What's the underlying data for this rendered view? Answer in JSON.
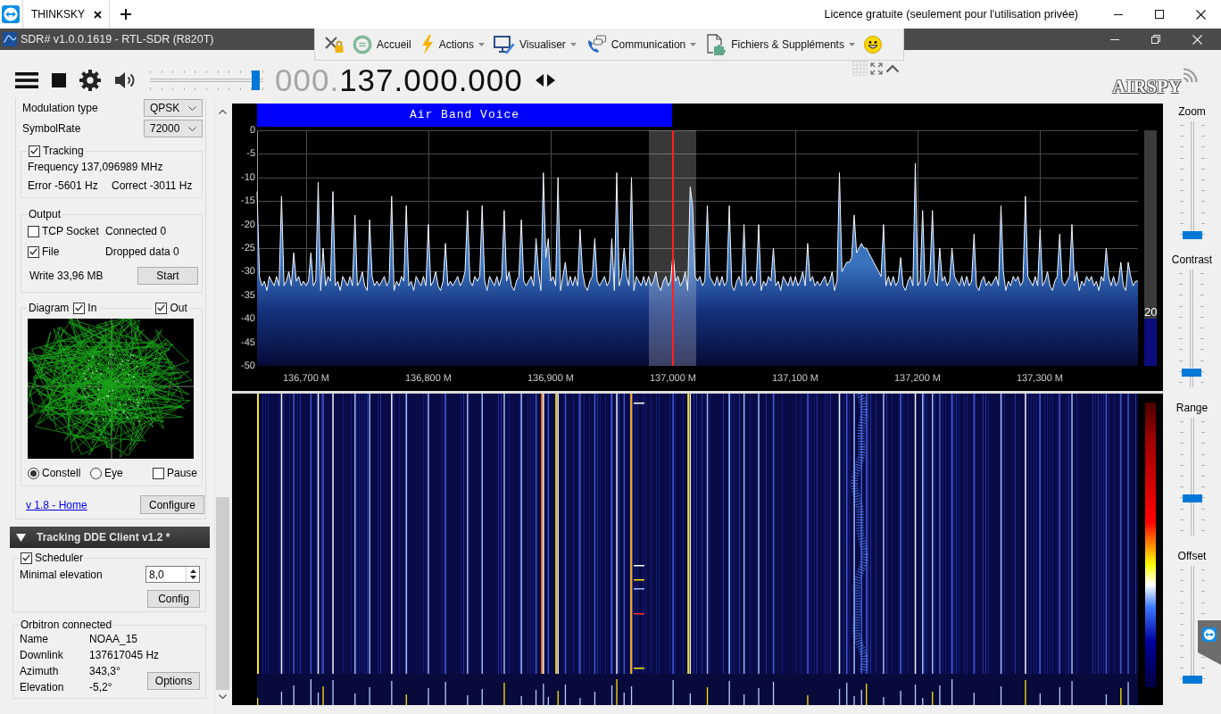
{
  "session_bar": {
    "tabs": [
      {
        "label": "THINKSKY",
        "selected": true
      }
    ],
    "license": "Licence gratuite (seulement pour l'utilisation privée)"
  },
  "window": {
    "title": "SDR# v1.0.0.1619 - RTL-SDR (R820T)"
  },
  "remote_toolbar": {
    "items": [
      {
        "label": "Accueil",
        "dropdown": false
      },
      {
        "label": "Actions",
        "dropdown": true
      },
      {
        "label": "Visualiser",
        "dropdown": true
      },
      {
        "label": "Communication",
        "dropdown": true
      },
      {
        "label": "Fichiers & Suppléments",
        "dropdown": true
      }
    ]
  },
  "radio_toolbar": {
    "volume": {
      "level": 0.97
    },
    "frequency": {
      "leading": "000.",
      "value": "137.000.000"
    },
    "logo": "AIRSPY"
  },
  "demodulator": {
    "fields": [
      {
        "label": "Modulation type",
        "value": "QPSK"
      },
      {
        "label": "SymbolRate",
        "value": "72000"
      }
    ],
    "tracking": {
      "label": "Tracking",
      "checked": true,
      "frequency": "Frequency 137,096989 MHz",
      "error": "Error -5601 Hz",
      "correct": "Correct -3011 Hz"
    },
    "output": {
      "title": "Output",
      "rows": [
        {
          "label": "TCP Socket",
          "checked": false,
          "status": "Connected 0"
        },
        {
          "label": "File",
          "checked": true,
          "status": "Dropped data 0"
        }
      ],
      "write": "Write 33,96 MB",
      "button": "Start"
    },
    "diagram": {
      "title": "Diagram",
      "channels": [
        {
          "label": "In",
          "checked": true
        },
        {
          "label": "Out",
          "checked": true
        }
      ],
      "modes": [
        {
          "label": "Constell",
          "selected": true
        },
        {
          "label": "Eye",
          "selected": false
        }
      ],
      "pause": {
        "label": "Pause",
        "checked": false
      }
    },
    "link": "v 1.8 - Home",
    "button": "Configure"
  },
  "dde_client": {
    "title": "Tracking DDE Client v1.2 *",
    "expanded": true,
    "scheduler": {
      "label": "Scheduler",
      "checked": true,
      "elevation_label": "Minimal elevation",
      "elevation": "8,0",
      "button": "Config"
    },
    "orbitron": {
      "title": "Orbitron connected",
      "rows": [
        {
          "label": "Name",
          "value": "NOAA_15"
        },
        {
          "label": "Downlink",
          "value": "137617045 Hz"
        },
        {
          "label": "Azimuth",
          "value": "343,3°"
        },
        {
          "label": "Elevation",
          "value": "-5,2°"
        }
      ],
      "button": "Options"
    }
  },
  "spectrum": {
    "band": "Air Band Voice",
    "gain": {
      "level": 0.2,
      "reading": "20"
    },
    "chart_data": {
      "type": "area",
      "xlim": [
        136660,
        137380
      ],
      "ylim": [
        -50,
        0
      ],
      "xticks": [
        {
          "value": 136700,
          "label": "136,700 M"
        },
        {
          "value": 136800,
          "label": "136,800 M"
        },
        {
          "value": 136900,
          "label": "136,900 M"
        },
        {
          "value": 137000,
          "label": "137,000 M"
        },
        {
          "value": 137100,
          "label": "137,100 M"
        },
        {
          "value": 137200,
          "label": "137,200 M"
        },
        {
          "value": 137300,
          "label": "137,300 M"
        }
      ],
      "yticks": [
        0,
        -5,
        -10,
        -15,
        -20,
        -25,
        -30,
        -35,
        -40,
        -45,
        -50
      ],
      "x": [
        136660,
        136660,
        136662,
        136664,
        136666,
        136668,
        136670,
        136672,
        136674,
        136676,
        136678,
        136680,
        136682,
        136684,
        136686,
        136688,
        136690,
        136692,
        136694,
        136696,
        136698,
        136700,
        136702,
        136704,
        136706,
        136708,
        136710,
        136712,
        136714,
        136716,
        136718,
        136720,
        136722,
        136724,
        136726,
        136728,
        136730,
        136732,
        136734,
        136736,
        136738,
        136740,
        136742,
        136744,
        136746,
        136748,
        136750,
        136752,
        136754,
        136756,
        136758,
        136760,
        136762,
        136764,
        136766,
        136768,
        136770,
        136772,
        136774,
        136776,
        136778,
        136780,
        136782,
        136784,
        136786,
        136788,
        136790,
        136792,
        136794,
        136796,
        136798,
        136800,
        136802,
        136804,
        136806,
        136808,
        136810,
        136812,
        136814,
        136816,
        136818,
        136820,
        136822,
        136824,
        136826,
        136828,
        136830,
        136832,
        136834,
        136836,
        136838,
        136840,
        136842,
        136844,
        136846,
        136848,
        136850,
        136852,
        136854,
        136856,
        136858,
        136860,
        136862,
        136864,
        136866,
        136868,
        136870,
        136872,
        136874,
        136876,
        136878,
        136880,
        136882,
        136884,
        136886,
        136888,
        136890,
        136892,
        136894,
        136896,
        136898,
        136900,
        136902,
        136904,
        136906,
        136908,
        136910,
        136912,
        136914,
        136916,
        136918,
        136920,
        136922,
        136924,
        136926,
        136928,
        136930,
        136932,
        136934,
        136936,
        136938,
        136940,
        136942,
        136944,
        136946,
        136948,
        136950,
        136952,
        136954,
        136956,
        136958,
        136960,
        136962,
        136964,
        136966,
        136968,
        136970,
        136972,
        136974,
        136976,
        136978,
        136980,
        136982,
        136984,
        136986,
        136988,
        136990,
        136992,
        136994,
        136996,
        136998,
        137000,
        137002,
        137004,
        137006,
        137008,
        137010,
        137012,
        137014,
        137016,
        137018,
        137020,
        137022,
        137024,
        137026,
        137028,
        137030,
        137032,
        137034,
        137036,
        137038,
        137040,
        137042,
        137044,
        137046,
        137048,
        137050,
        137052,
        137054,
        137056,
        137058,
        137060,
        137062,
        137064,
        137066,
        137068,
        137070,
        137072,
        137074,
        137076,
        137078,
        137080,
        137082,
        137084,
        137086,
        137088,
        137090,
        137092,
        137094,
        137096,
        137098,
        137100,
        137102,
        137104,
        137106,
        137108,
        137110,
        137112,
        137114,
        137116,
        137118,
        137120,
        137122,
        137124,
        137126,
        137128,
        137130,
        137132,
        137134,
        137136,
        137138,
        137140,
        137142,
        137144,
        137146,
        137148,
        137150,
        137152,
        137154,
        137156,
        137158,
        137160,
        137162,
        137164,
        137166,
        137168,
        137170,
        137172,
        137174,
        137176,
        137178,
        137180,
        137182,
        137184,
        137186,
        137188,
        137190,
        137192,
        137194,
        137196,
        137198,
        137200,
        137202,
        137204,
        137206,
        137208,
        137210,
        137212,
        137214,
        137216,
        137218,
        137220,
        137222,
        137224,
        137226,
        137228,
        137230,
        137232,
        137234,
        137236,
        137238,
        137240,
        137242,
        137244,
        137246,
        137248,
        137250,
        137252,
        137254,
        137256,
        137258,
        137260,
        137262,
        137264,
        137266,
        137268,
        137270,
        137272,
        137274,
        137276,
        137278,
        137280,
        137282,
        137284,
        137286,
        137288,
        137290,
        137292,
        137294,
        137296,
        137298,
        137300,
        137302,
        137304,
        137306,
        137308,
        137310,
        137312,
        137314,
        137316,
        137318,
        137320,
        137322,
        137324,
        137326,
        137328,
        137330,
        137332,
        137334,
        137336,
        137338,
        137340,
        137342,
        137344,
        137346,
        137348,
        137350,
        137352,
        137354,
        137356,
        137358,
        137360,
        137362,
        137364,
        137366,
        137368,
        137370,
        137372,
        137374,
        137376,
        137378,
        137380,
        137380
      ],
      "series": [
        {
          "color": "#f4f8ff",
          "values": [
            -50,
            -13,
            -31,
            -33,
            -32,
            -34,
            -31,
            -32,
            -33,
            -31,
            -33,
            -14,
            -33,
            -32,
            -30,
            -33,
            -26,
            -32,
            -31,
            -33,
            -32,
            -33,
            -32,
            -26,
            -33,
            -32,
            -11,
            -34,
            -25,
            -33,
            -31,
            -32,
            -13,
            -33,
            -32,
            -34,
            -31,
            -32,
            -33,
            -31,
            -33,
            -18,
            -33,
            -32,
            -30,
            -33,
            -34,
            -19,
            -31,
            -33,
            -32,
            -33,
            -32,
            -31,
            -33,
            -32,
            -14,
            -34,
            -32,
            -33,
            -31,
            -32,
            -16,
            -33,
            -32,
            -34,
            -31,
            -32,
            -33,
            -31,
            -33,
            -20,
            -33,
            -32,
            -30,
            -33,
            -34,
            -32,
            -24,
            -33,
            -32,
            -33,
            -32,
            -31,
            -33,
            -32,
            -30,
            -17,
            -32,
            -33,
            -31,
            -32,
            -31,
            -16,
            -32,
            -34,
            -31,
            -32,
            -33,
            -31,
            -33,
            -31,
            -17,
            -32,
            -30,
            -33,
            -34,
            -32,
            -31,
            -19,
            -32,
            -33,
            -32,
            -31,
            -33,
            -23,
            -30,
            -34,
            -9,
            -27,
            -23,
            -32,
            -31,
            -33,
            -10,
            -34,
            -31,
            -28,
            -33,
            -31,
            -33,
            -31,
            -33,
            -21,
            -30,
            -33,
            -34,
            -32,
            -31,
            -23,
            -32,
            -33,
            -32,
            -31,
            -33,
            -32,
            -23,
            -34,
            -9,
            -33,
            -31,
            -25,
            -31,
            -33,
            -10,
            -34,
            -31,
            -32,
            -33,
            -31,
            -33,
            -31,
            -33,
            -32,
            -30,
            -33,
            -34,
            -32,
            -31,
            -33,
            -32,
            -26,
            -32,
            -31,
            -33,
            -32,
            -30,
            -34,
            -12,
            -16,
            -31,
            -32,
            -31,
            -33,
            -32,
            -16,
            -31,
            -32,
            -33,
            -31,
            -33,
            -31,
            -33,
            -32,
            -16,
            -33,
            -34,
            -32,
            -31,
            -33,
            -20,
            -33,
            -32,
            -31,
            -33,
            -32,
            -20,
            -34,
            -32,
            -33,
            -31,
            -32,
            -25,
            -33,
            -32,
            -34,
            -31,
            -32,
            -33,
            -31,
            -33,
            -31,
            -33,
            -32,
            -30,
            -33,
            -24,
            -32,
            -31,
            -33,
            -32,
            -33,
            -32,
            -31,
            -33,
            -32,
            -30,
            -34,
            -32,
            -9,
            -30,
            -29,
            -28,
            -28,
            -27,
            -18,
            -26,
            -25,
            -24,
            -25,
            -25,
            -26,
            -27,
            -28,
            -29,
            -30,
            -31,
            -20,
            -33,
            -31,
            -33,
            -31,
            -33,
            -32,
            -27,
            -33,
            -34,
            -32,
            -31,
            -33,
            -7,
            -33,
            -32,
            -17,
            -33,
            -32,
            -30,
            -17,
            -32,
            -33,
            -25,
            -32,
            -31,
            -33,
            -32,
            -25,
            -31,
            -32,
            -33,
            -31,
            -33,
            -31,
            -33,
            -32,
            -22,
            -33,
            -34,
            -32,
            -31,
            -33,
            -32,
            -33,
            -32,
            -31,
            -33,
            -16,
            -30,
            -34,
            -32,
            -33,
            -31,
            -32,
            -31,
            -33,
            -32,
            -14,
            -31,
            -32,
            -33,
            -31,
            -33,
            -21,
            -33,
            -32,
            -30,
            -33,
            -34,
            -32,
            -31,
            -22,
            -32,
            -33,
            -32,
            -31,
            -20,
            -32,
            -30,
            -34,
            -32,
            -33,
            -31,
            -32,
            -31,
            -33,
            -32,
            -34,
            -31,
            -32,
            -25,
            -31,
            -33,
            -31,
            -33,
            -32,
            -28,
            -33,
            -34,
            -28,
            -31,
            -33,
            -32,
            -32,
            -50
          ]
        }
      ]
    }
  },
  "side_sliders": [
    {
      "label": "Zoom",
      "level": 0
    },
    {
      "label": "Contrast",
      "level": 0.1
    },
    {
      "label": "Range",
      "level": 0.3
    },
    {
      "label": "Offset",
      "level": 0
    }
  ]
}
